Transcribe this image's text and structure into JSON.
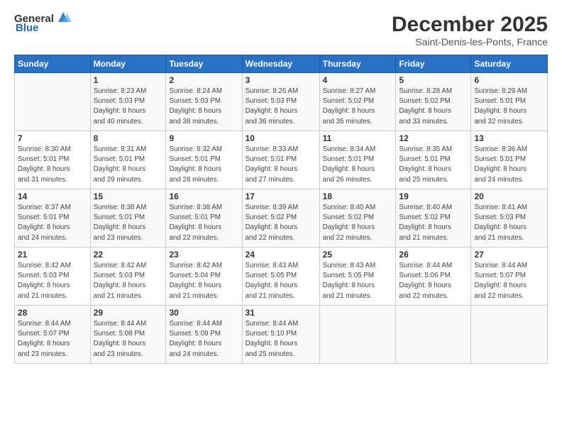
{
  "logo": {
    "general": "General",
    "blue": "Blue"
  },
  "header": {
    "title": "December 2025",
    "subtitle": "Saint-Denis-les-Ponts, France"
  },
  "weekdays": [
    "Sunday",
    "Monday",
    "Tuesday",
    "Wednesday",
    "Thursday",
    "Friday",
    "Saturday"
  ],
  "weeks": [
    [
      {
        "day": "",
        "info": ""
      },
      {
        "day": "1",
        "info": "Sunrise: 8:23 AM\nSunset: 5:03 PM\nDaylight: 8 hours\nand 40 minutes."
      },
      {
        "day": "2",
        "info": "Sunrise: 8:24 AM\nSunset: 5:03 PM\nDaylight: 8 hours\nand 38 minutes."
      },
      {
        "day": "3",
        "info": "Sunrise: 8:26 AM\nSunset: 5:03 PM\nDaylight: 8 hours\nand 36 minutes."
      },
      {
        "day": "4",
        "info": "Sunrise: 8:27 AM\nSunset: 5:02 PM\nDaylight: 8 hours\nand 35 minutes."
      },
      {
        "day": "5",
        "info": "Sunrise: 8:28 AM\nSunset: 5:02 PM\nDaylight: 8 hours\nand 33 minutes."
      },
      {
        "day": "6",
        "info": "Sunrise: 8:29 AM\nSunset: 5:01 PM\nDaylight: 8 hours\nand 32 minutes."
      }
    ],
    [
      {
        "day": "7",
        "info": "Sunrise: 8:30 AM\nSunset: 5:01 PM\nDaylight: 8 hours\nand 31 minutes."
      },
      {
        "day": "8",
        "info": "Sunrise: 8:31 AM\nSunset: 5:01 PM\nDaylight: 8 hours\nand 29 minutes."
      },
      {
        "day": "9",
        "info": "Sunrise: 8:32 AM\nSunset: 5:01 PM\nDaylight: 8 hours\nand 28 minutes."
      },
      {
        "day": "10",
        "info": "Sunrise: 8:33 AM\nSunset: 5:01 PM\nDaylight: 8 hours\nand 27 minutes."
      },
      {
        "day": "11",
        "info": "Sunrise: 8:34 AM\nSunset: 5:01 PM\nDaylight: 8 hours\nand 26 minutes."
      },
      {
        "day": "12",
        "info": "Sunrise: 8:35 AM\nSunset: 5:01 PM\nDaylight: 8 hours\nand 25 minutes."
      },
      {
        "day": "13",
        "info": "Sunrise: 8:36 AM\nSunset: 5:01 PM\nDaylight: 8 hours\nand 24 minutes."
      }
    ],
    [
      {
        "day": "14",
        "info": "Sunrise: 8:37 AM\nSunset: 5:01 PM\nDaylight: 8 hours\nand 24 minutes."
      },
      {
        "day": "15",
        "info": "Sunrise: 8:38 AM\nSunset: 5:01 PM\nDaylight: 8 hours\nand 23 minutes."
      },
      {
        "day": "16",
        "info": "Sunrise: 8:38 AM\nSunset: 5:01 PM\nDaylight: 8 hours\nand 22 minutes."
      },
      {
        "day": "17",
        "info": "Sunrise: 8:39 AM\nSunset: 5:02 PM\nDaylight: 8 hours\nand 22 minutes."
      },
      {
        "day": "18",
        "info": "Sunrise: 8:40 AM\nSunset: 5:02 PM\nDaylight: 8 hours\nand 22 minutes."
      },
      {
        "day": "19",
        "info": "Sunrise: 8:40 AM\nSunset: 5:02 PM\nDaylight: 8 hours\nand 21 minutes."
      },
      {
        "day": "20",
        "info": "Sunrise: 8:41 AM\nSunset: 5:03 PM\nDaylight: 8 hours\nand 21 minutes."
      }
    ],
    [
      {
        "day": "21",
        "info": "Sunrise: 8:42 AM\nSunset: 5:03 PM\nDaylight: 8 hours\nand 21 minutes."
      },
      {
        "day": "22",
        "info": "Sunrise: 8:42 AM\nSunset: 5:03 PM\nDaylight: 8 hours\nand 21 minutes."
      },
      {
        "day": "23",
        "info": "Sunrise: 8:42 AM\nSunset: 5:04 PM\nDaylight: 8 hours\nand 21 minutes."
      },
      {
        "day": "24",
        "info": "Sunrise: 8:43 AM\nSunset: 5:05 PM\nDaylight: 8 hours\nand 21 minutes."
      },
      {
        "day": "25",
        "info": "Sunrise: 8:43 AM\nSunset: 5:05 PM\nDaylight: 8 hours\nand 21 minutes."
      },
      {
        "day": "26",
        "info": "Sunrise: 8:44 AM\nSunset: 5:06 PM\nDaylight: 8 hours\nand 22 minutes."
      },
      {
        "day": "27",
        "info": "Sunrise: 8:44 AM\nSunset: 5:07 PM\nDaylight: 8 hours\nand 22 minutes."
      }
    ],
    [
      {
        "day": "28",
        "info": "Sunrise: 8:44 AM\nSunset: 5:07 PM\nDaylight: 8 hours\nand 23 minutes."
      },
      {
        "day": "29",
        "info": "Sunrise: 8:44 AM\nSunset: 5:08 PM\nDaylight: 8 hours\nand 23 minutes."
      },
      {
        "day": "30",
        "info": "Sunrise: 8:44 AM\nSunset: 5:09 PM\nDaylight: 8 hours\nand 24 minutes."
      },
      {
        "day": "31",
        "info": "Sunrise: 8:44 AM\nSunset: 5:10 PM\nDaylight: 8 hours\nand 25 minutes."
      },
      {
        "day": "",
        "info": ""
      },
      {
        "day": "",
        "info": ""
      },
      {
        "day": "",
        "info": ""
      }
    ]
  ]
}
